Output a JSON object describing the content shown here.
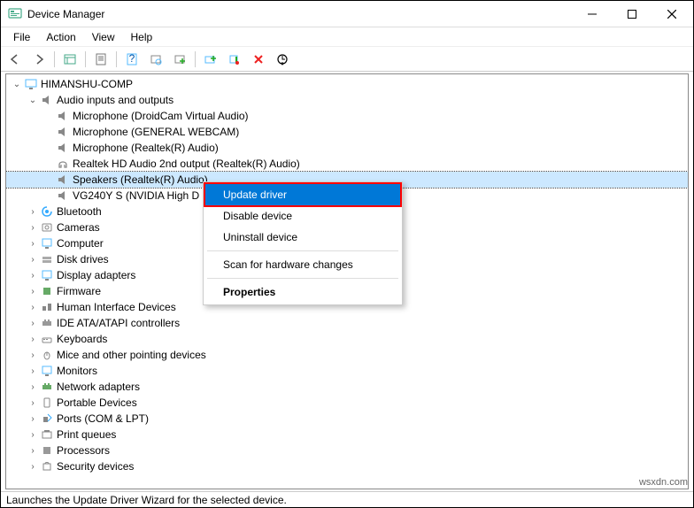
{
  "window": {
    "title": "Device Manager"
  },
  "menu": {
    "file": "File",
    "action": "Action",
    "view": "View",
    "help": "Help"
  },
  "tree": {
    "root": "HIMANSHU-COMP",
    "audio": "Audio inputs and outputs",
    "audio_children": [
      "Microphone (DroidCam Virtual Audio)",
      "Microphone (GENERAL WEBCAM)",
      "Microphone (Realtek(R) Audio)",
      "Realtek HD Audio 2nd output (Realtek(R) Audio)",
      "Speakers (Realtek(R) Audio)",
      "VG240Y S (NVIDIA High D"
    ],
    "categories": [
      "Bluetooth",
      "Cameras",
      "Computer",
      "Disk drives",
      "Display adapters",
      "Firmware",
      "Human Interface Devices",
      "IDE ATA/ATAPI controllers",
      "Keyboards",
      "Mice and other pointing devices",
      "Monitors",
      "Network adapters",
      "Portable Devices",
      "Ports (COM & LPT)",
      "Print queues",
      "Processors",
      "Security devices"
    ]
  },
  "context_menu": {
    "update": "Update driver",
    "disable": "Disable device",
    "uninstall": "Uninstall device",
    "scan": "Scan for hardware changes",
    "properties": "Properties"
  },
  "status": "Launches the Update Driver Wizard for the selected device.",
  "watermark": "wsxdn.com"
}
